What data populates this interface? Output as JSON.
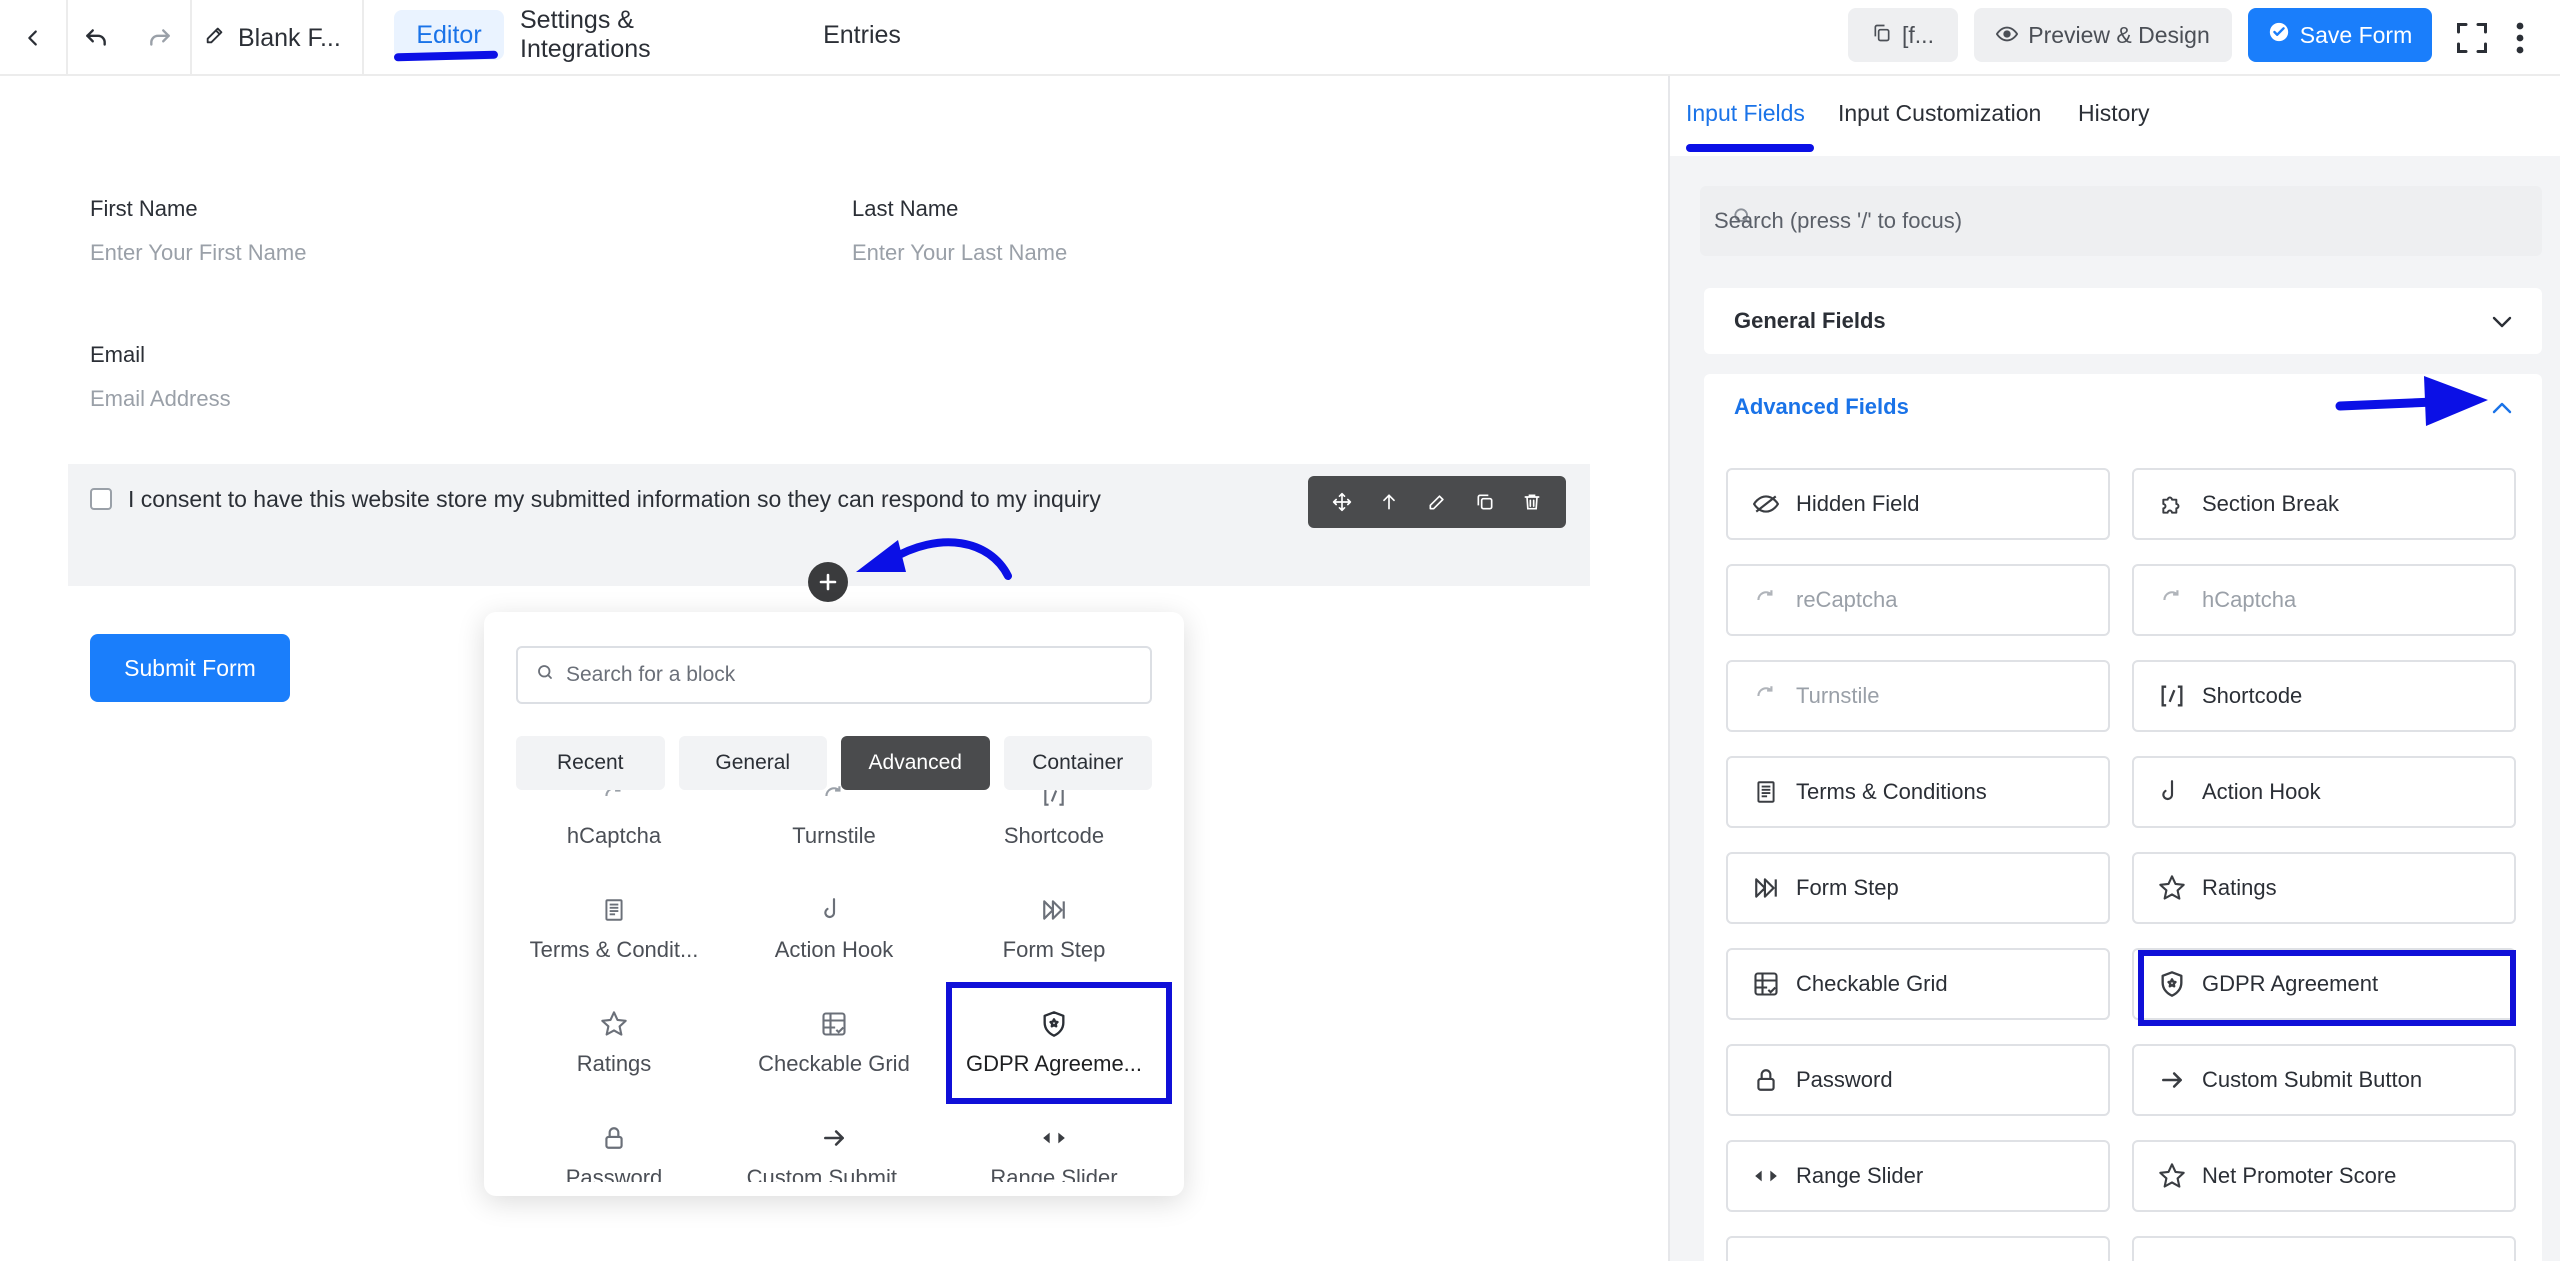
{
  "topbar": {
    "form_title": "Blank F...",
    "tabs": [
      {
        "label": "Editor",
        "active": true
      },
      {
        "label": "Settings & Integrations",
        "active": false
      },
      {
        "label": "Entries",
        "active": false
      }
    ],
    "shortcode_label": "[f...",
    "preview_label": "Preview & Design",
    "save_label": "Save Form"
  },
  "form": {
    "first_name": {
      "label": "First Name",
      "placeholder": "Enter Your First Name"
    },
    "last_name": {
      "label": "Last Name",
      "placeholder": "Enter Your Last Name"
    },
    "email": {
      "label": "Email",
      "placeholder": "Email Address"
    },
    "consent_text": "I consent to have this website store my submitted information so they can respond to my inquiry",
    "submit_label": "Submit Form"
  },
  "block_popup": {
    "search_placeholder": "Search for a block",
    "tabs": [
      "Recent",
      "General",
      "Advanced",
      "Container"
    ],
    "active_tab": "Advanced",
    "items": [
      {
        "label": "hCaptcha",
        "icon": "captcha-icon"
      },
      {
        "label": "Turnstile",
        "icon": "captcha-icon"
      },
      {
        "label": "Shortcode",
        "icon": "shortcode-icon"
      },
      {
        "label": "Terms & Condit...",
        "icon": "document-icon"
      },
      {
        "label": "Action Hook",
        "icon": "hook-icon"
      },
      {
        "label": "Form Step",
        "icon": "step-forward-icon"
      },
      {
        "label": "Ratings",
        "icon": "star-icon"
      },
      {
        "label": "Checkable Grid",
        "icon": "grid-check-icon"
      },
      {
        "label": "GDPR Agreeme...",
        "icon": "shield-icon",
        "highlighted": true
      },
      {
        "label": "Password",
        "icon": "lock-icon"
      },
      {
        "label": "Custom Submit ...",
        "icon": "arrow-right-icon"
      },
      {
        "label": "Range Slider",
        "icon": "range-slider-icon"
      }
    ]
  },
  "sidepanel": {
    "tabs": [
      {
        "label": "Input Fields",
        "active": true
      },
      {
        "label": "Input Customization",
        "active": false
      },
      {
        "label": "History",
        "active": false
      }
    ],
    "search_placeholder": "Search (press '/' to focus)",
    "general_fields_label": "General Fields",
    "advanced_fields_label": "Advanced Fields",
    "advanced_fields": [
      {
        "label": "Hidden Field",
        "icon": "eye-slash-icon",
        "disabled": false
      },
      {
        "label": "Section Break",
        "icon": "puzzle-icon",
        "disabled": false
      },
      {
        "label": "reCaptcha",
        "icon": "captcha-icon",
        "disabled": true
      },
      {
        "label": "hCaptcha",
        "icon": "captcha-icon",
        "disabled": true
      },
      {
        "label": "Turnstile",
        "icon": "captcha-icon",
        "disabled": true
      },
      {
        "label": "Shortcode",
        "icon": "shortcode-icon",
        "disabled": false
      },
      {
        "label": "Terms & Conditions",
        "icon": "document-icon",
        "disabled": false
      },
      {
        "label": "Action Hook",
        "icon": "hook-icon",
        "disabled": false
      },
      {
        "label": "Form Step",
        "icon": "step-forward-icon",
        "disabled": false
      },
      {
        "label": "Ratings",
        "icon": "star-icon",
        "disabled": false
      },
      {
        "label": "Checkable Grid",
        "icon": "grid-check-icon",
        "disabled": false
      },
      {
        "label": "GDPR Agreement",
        "icon": "shield-icon",
        "disabled": false,
        "highlighted": true
      },
      {
        "label": "Password",
        "icon": "lock-icon",
        "disabled": false
      },
      {
        "label": "Custom Submit Button",
        "icon": "arrow-right-icon",
        "disabled": false
      },
      {
        "label": "Range Slider",
        "icon": "range-slider-icon",
        "disabled": false
      },
      {
        "label": "Net Promoter Score",
        "icon": "star-outline-icon",
        "disabled": false
      }
    ]
  },
  "colors": {
    "accent": "#1a7efb",
    "annotation": "#0b10e6",
    "toolbar_dark": "#4a4b4d"
  }
}
